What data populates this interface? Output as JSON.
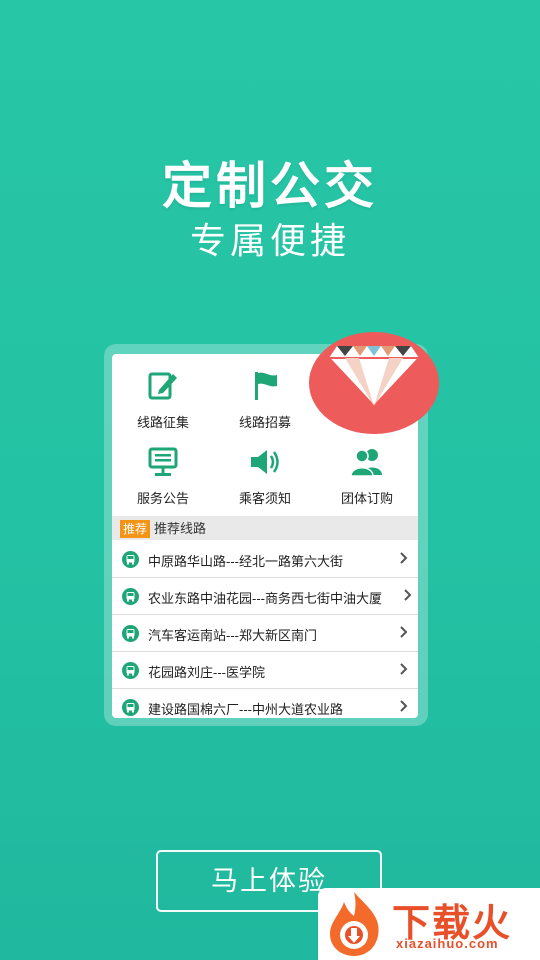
{
  "hero": {
    "title": "定制公交",
    "subtitle": "专属便捷"
  },
  "features": [
    {
      "label": "线路征集",
      "icon": "edit-note-icon"
    },
    {
      "label": "线路招募",
      "icon": "flag-icon"
    },
    {
      "label": "服务公告",
      "icon": "notice-board-icon"
    },
    {
      "label": "乘客须知",
      "icon": "speaker-icon"
    },
    {
      "label": "团体订购",
      "icon": "group-people-icon"
    }
  ],
  "section": {
    "tag": "推荐",
    "label": "推荐线路"
  },
  "routes": [
    "中原路华山路---经北一路第六大街",
    "农业东路中油花园---商务西七街中油大厦",
    "汽车客运南站---郑大新区南门",
    "花园路刘庄---医学院",
    "建设路国棉六厂---中州大道农业路"
  ],
  "cta": {
    "label": "马上体验"
  },
  "watermark": {
    "name": "下载火",
    "site": "xiazaihuo.com"
  },
  "colors": {
    "background": "#24c2a4",
    "icon_green": "#1fa677",
    "tag_orange": "#f39417",
    "badge_red": "#ee5b5b",
    "watermark_red": "#e8502a"
  }
}
